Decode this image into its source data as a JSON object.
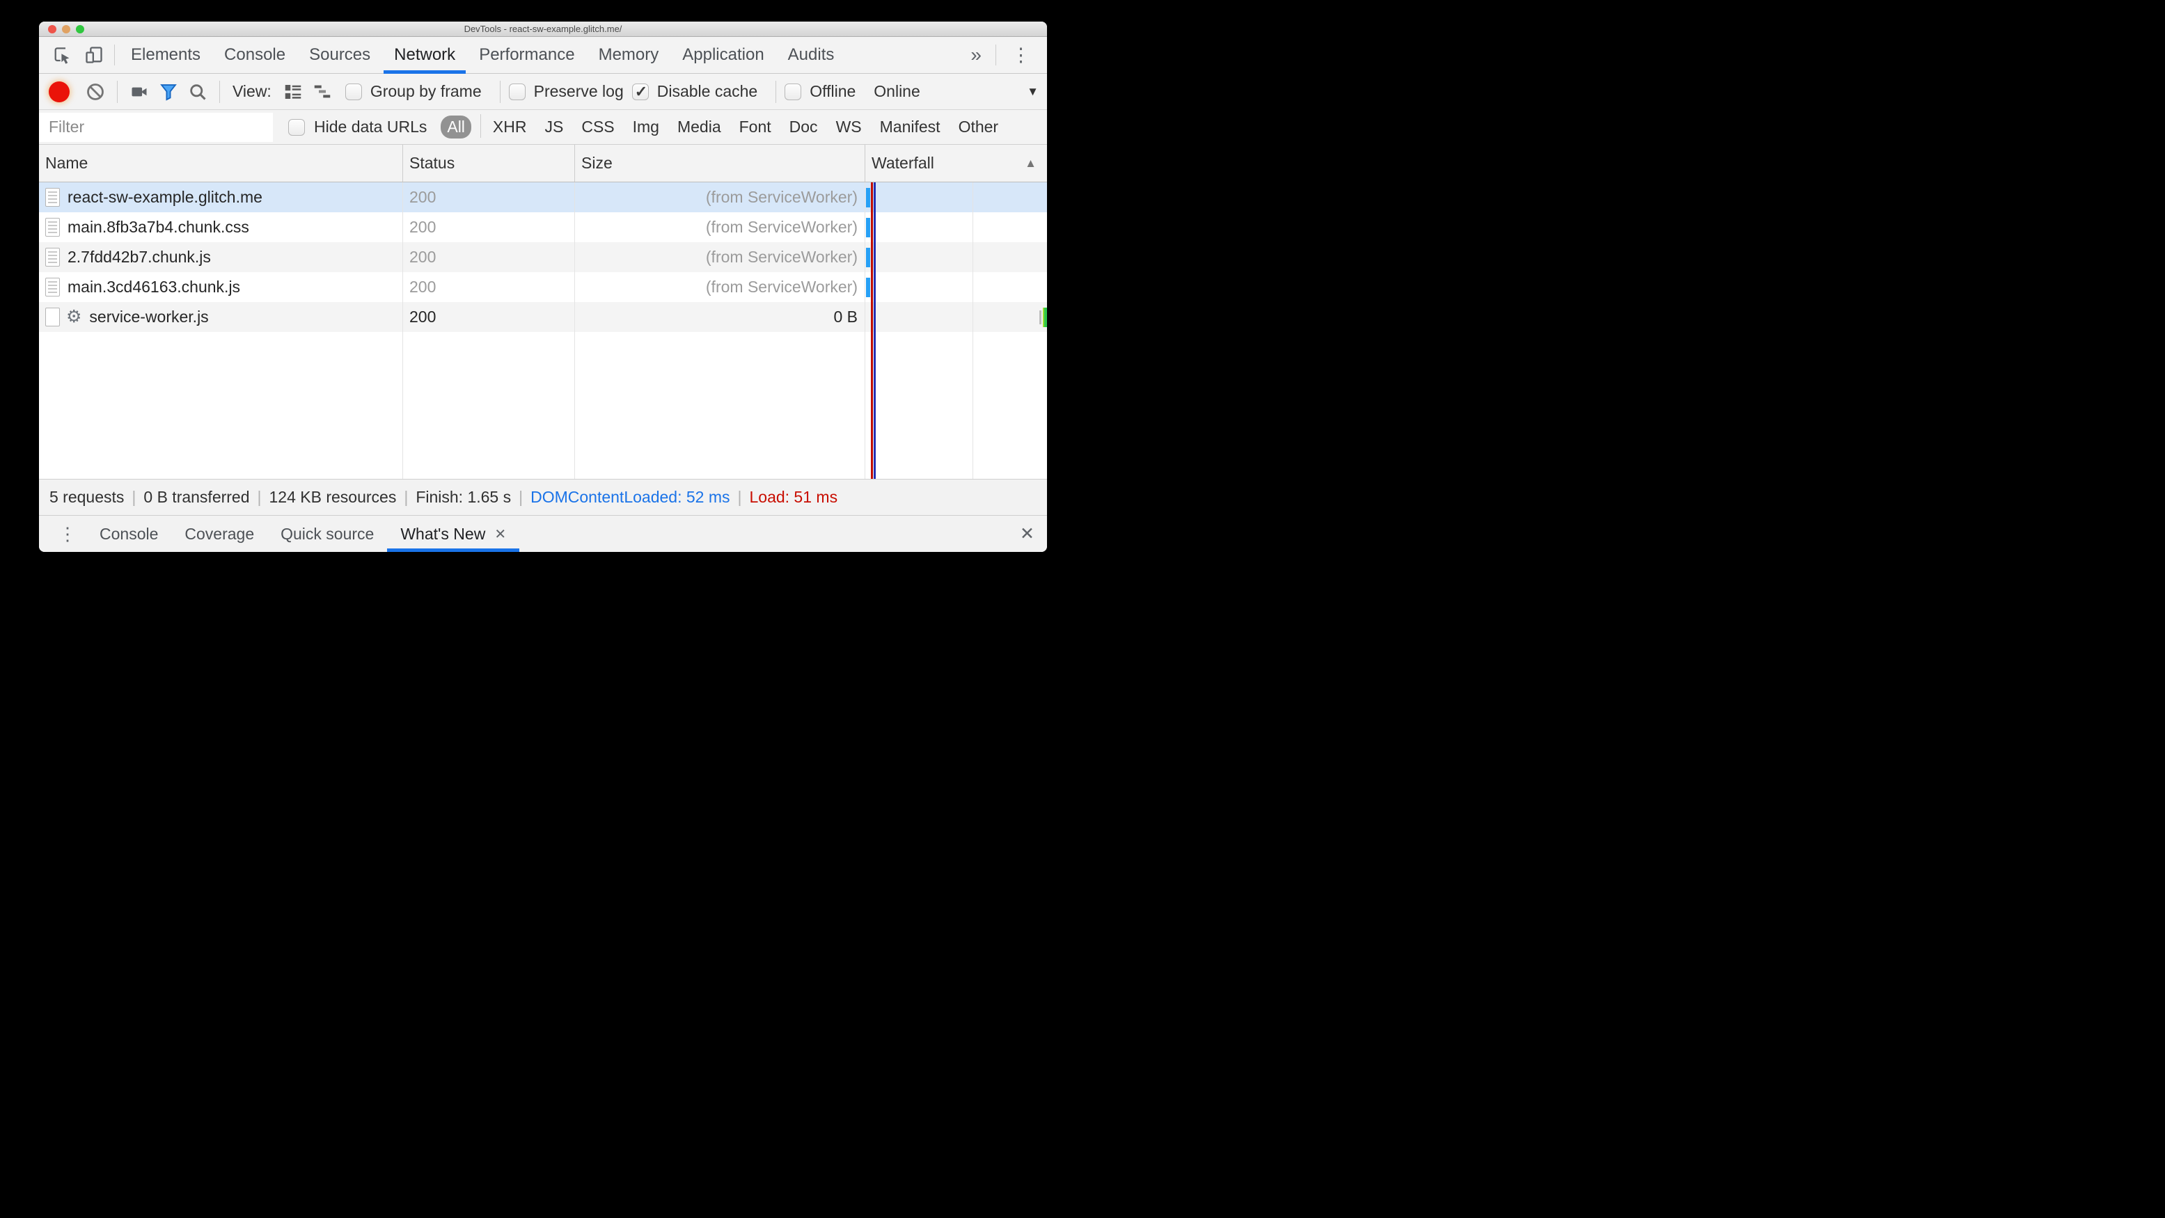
{
  "colors": {
    "accent": "#1a73e8",
    "selection": "#d7e7f9",
    "stripe": "#f4f4f4",
    "wf-blue": "#27a0f5",
    "wf-green": "#2fc84c",
    "line-red": "#c00d00",
    "line-navy": "#2430b4",
    "record-red": "#ea1309",
    "funnel-blue": "#4aa4f5",
    "pill-bg": "#929292",
    "sum-blue": "#1a73e8",
    "sum-red": "#c80d00"
  },
  "icons": {
    "gear": "⚙",
    "close": "✕",
    "kebab": "⋮",
    "overflow": "»",
    "dropdown": "▼",
    "sort_asc": "▲"
  },
  "titlebar": {
    "title": "DevTools - react-sw-example.glitch.me/"
  },
  "tabs": {
    "items": [
      {
        "label": "Elements"
      },
      {
        "label": "Console"
      },
      {
        "label": "Sources"
      },
      {
        "label": "Network",
        "active": true
      },
      {
        "label": "Performance"
      },
      {
        "label": "Memory"
      },
      {
        "label": "Application"
      },
      {
        "label": "Audits"
      }
    ]
  },
  "toolbar": {
    "view_label": "View:",
    "checkboxes": [
      {
        "label": "Group by frame",
        "checked": false,
        "sep_after": true
      },
      {
        "label": "Preserve log",
        "checked": false
      },
      {
        "label": "Disable cache",
        "checked": true,
        "sep_after": true
      },
      {
        "label": "Offline",
        "checked": false
      }
    ],
    "throttling_label": "Online"
  },
  "filterbar": {
    "placeholder": "Filter",
    "hide_data_urls_label": "Hide data URLs",
    "pills": [
      {
        "label": "All",
        "active": true,
        "sep_after": true
      },
      {
        "label": "XHR"
      },
      {
        "label": "JS"
      },
      {
        "label": "CSS"
      },
      {
        "label": "Img"
      },
      {
        "label": "Media"
      },
      {
        "label": "Font"
      },
      {
        "label": "Doc"
      },
      {
        "label": "WS"
      },
      {
        "label": "Manifest"
      },
      {
        "label": "Other"
      }
    ]
  },
  "table": {
    "columns": [
      "Name",
      "Status",
      "Size",
      "Waterfall"
    ],
    "rows": [
      {
        "name": "react-sw-example.glitch.me",
        "status": "200",
        "size": "(from ServiceWorker)",
        "icon": "doc",
        "selected": true,
        "muted": true,
        "waterfall": "start-blue"
      },
      {
        "name": "main.8fb3a7b4.chunk.css",
        "status": "200",
        "size": "(from ServiceWorker)",
        "icon": "doc",
        "muted": true,
        "waterfall": "start-blue"
      },
      {
        "name": "2.7fdd42b7.chunk.js",
        "status": "200",
        "size": "(from ServiceWorker)",
        "icon": "doc",
        "muted": true,
        "waterfall": "start-blue"
      },
      {
        "name": "main.3cd46163.chunk.js",
        "status": "200",
        "size": "(from ServiceWorker)",
        "icon": "doc",
        "muted": true,
        "waterfall": "start-blue"
      },
      {
        "name": "service-worker.js",
        "status": "200",
        "size": "0 B",
        "icon": "gear",
        "muted": false,
        "waterfall": "end-green"
      }
    ]
  },
  "summary": {
    "items": [
      {
        "text": "5 requests"
      },
      {
        "text": "|",
        "divider": true
      },
      {
        "text": "0 B transferred"
      },
      {
        "text": "|",
        "divider": true
      },
      {
        "text": "124 KB resources"
      },
      {
        "text": "|",
        "divider": true
      },
      {
        "text": "Finish: 1.65 s"
      },
      {
        "text": "|",
        "divider": true
      },
      {
        "text": "DOMContentLoaded: 52 ms",
        "blue": true
      },
      {
        "text": "|",
        "divider": true
      },
      {
        "text": "Load: 51 ms",
        "red": true
      }
    ]
  },
  "drawer": {
    "tabs": [
      {
        "label": "Console"
      },
      {
        "label": "Coverage"
      },
      {
        "label": "Quick source"
      },
      {
        "label": "What's New",
        "active": true,
        "closable": true
      }
    ]
  }
}
